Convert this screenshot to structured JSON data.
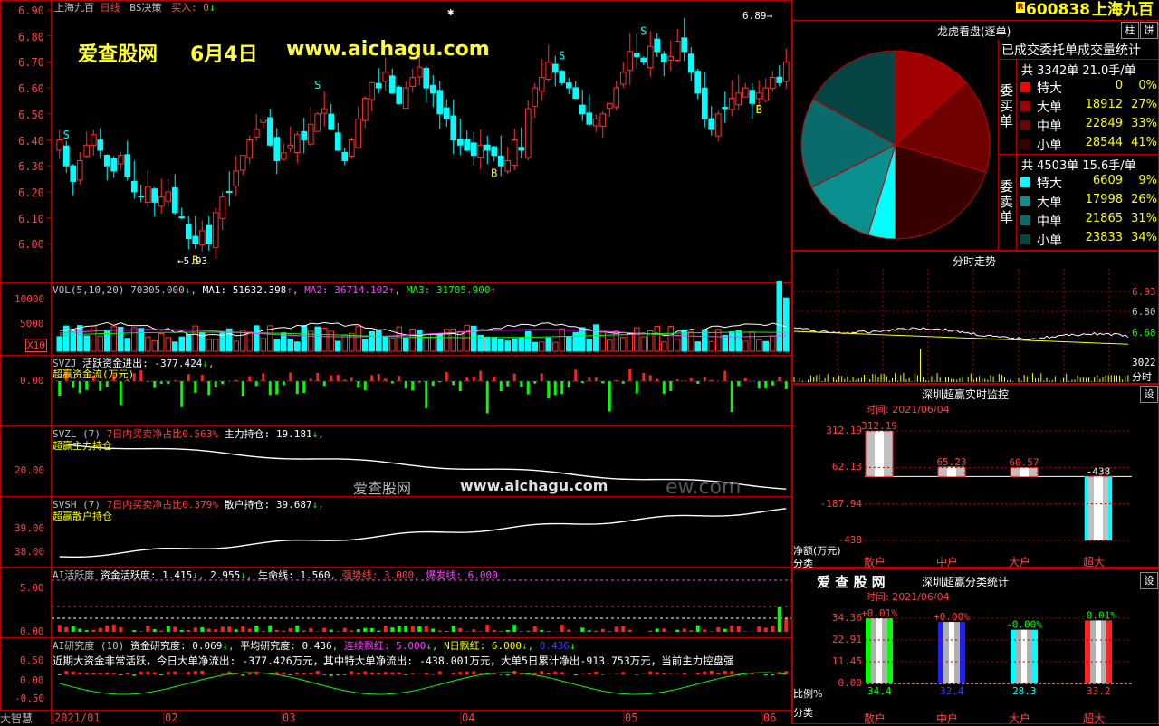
{
  "header": {
    "stock_name": "上海九百",
    "chart_mode": "日线",
    "formula_name": "BS决策",
    "buy_label": "买入: 0",
    "buy_arrow": "↓",
    "stock_code": "600838",
    "badge": "R"
  },
  "watermark": {
    "brand": "爱查股网",
    "date": "6月4日",
    "url": "www.aichagu.com",
    "mid_brand": "爱查股网",
    "mid_url": "www.aichagu.com",
    "mid_tail": "ew.com"
  },
  "main_chart": {
    "y_ticks": [
      "6.90",
      "6.80",
      "6.70",
      "6.60",
      "6.50",
      "6.40",
      "6.30",
      "6.20",
      "6.10",
      "6.00"
    ],
    "high_label": "6.89",
    "low_label": "5.93",
    "x_ticks": [
      "2021/01",
      "02",
      "03",
      "04",
      "05",
      "06"
    ],
    "signals_s": "S",
    "signals_b": "B"
  },
  "vol_panel": {
    "title": "VOL(5,10,20)",
    "vol": "70305.000",
    "ma1_label": "MA1: 51632.398",
    "ma2_label": "MA2: 36714.102",
    "ma3_label": "MA3: 31705.900",
    "y_ticks": [
      "10000",
      "5000"
    ],
    "unit": "X10"
  },
  "svzj_panel": {
    "title": "SVZJ",
    "line1": "活跃资金进出: -377.424",
    "line2": "超赢资金流(万元)",
    "y_tick": "0.00"
  },
  "svzl_panel": {
    "title": "SVZL (7)",
    "ratio_label": "7日内买卖净占比0.563%",
    "hold_label": "主力持仓: 19.181",
    "sub_label": "超赢主力持仓",
    "y_tick": "20.00"
  },
  "svsh_panel": {
    "title": "SVSH (7)",
    "ratio_label": "7日内买卖净占比0.379%",
    "hold_label": "散户持仓: 39.687",
    "sub_label": "超赢散户持仓",
    "y_ticks": [
      "39.00",
      "38.00"
    ]
  },
  "ai_active_panel": {
    "title": "AI活跃度",
    "activity": "资金活跃度: 1.415",
    "value2": "2.955",
    "life_line": "生命线: 1.560",
    "strong_line": "强势线: 3.000",
    "burst_line": "爆发线: 6.000",
    "y_ticks": [
      "5.00",
      "0.00"
    ]
  },
  "ai_research_panel": {
    "title": "AI研究度 (10)",
    "research": "资金研究度: 0.069",
    "avg_research": "平均研究度: 0.436",
    "consecutive": "连续飘红: 5.000",
    "n_day": "N日飘红: 6.000",
    "extra": "0.436",
    "summary": "近期大资金非常活跃，今日大单净流出: -377.426万元，其中特大单净流出: -438.001万元，大单5日累计净出-913.753万元，当前主力控盘强",
    "y_ticks": [
      "0.50",
      "0.00",
      "-0.50"
    ]
  },
  "footer": {
    "logo": "大智慧"
  },
  "dragon_panel": {
    "title": "龙虎看盘(逐单)",
    "tab_col": "柱",
    "tab_pie": "饼",
    "stats_title": "已成交委托单成交量统计",
    "buy_side_label": "委买单",
    "sell_side_label": "委卖单",
    "buy_total": "共 3342单 21.0手/单",
    "sell_total": "共 4503单 15.6手/单",
    "buy_rows": [
      {
        "label": "特大",
        "count": "0",
        "pct": "0%",
        "color": "#ff0000"
      },
      {
        "label": "大单",
        "count": "18912",
        "pct": "27%",
        "color": "#a00000"
      },
      {
        "label": "中单",
        "count": "22849",
        "pct": "33%",
        "color": "#700000"
      },
      {
        "label": "小单",
        "count": "28544",
        "pct": "41%",
        "color": "#3a0000"
      }
    ],
    "sell_rows": [
      {
        "label": "特大",
        "count": "6609",
        "pct": "9%",
        "color": "#00ffff"
      },
      {
        "label": "大单",
        "count": "17998",
        "pct": "26%",
        "color": "#0a8f8f"
      },
      {
        "label": "中单",
        "count": "21865",
        "pct": "31%",
        "color": "#0a6b6b"
      },
      {
        "label": "小单",
        "count": "23833",
        "pct": "34%",
        "color": "#064444"
      }
    ]
  },
  "intraday_panel": {
    "title": "分时走势",
    "price_ticks": [
      "6.93",
      "6.80",
      "6.68"
    ],
    "volume_label": "3022",
    "volume_unit": "分时"
  },
  "monitor_panel": {
    "title": "深圳超赢实时监控",
    "settings": "设",
    "time_label": "时间: 2021/06/04",
    "y_ticks": [
      "312.19",
      "62.13",
      "-187.94",
      "-438"
    ],
    "unit_label": "净额(万元)",
    "class_label": "分类",
    "categories": [
      "散户",
      "中户",
      "大户",
      "超大"
    ]
  },
  "classify_panel": {
    "brand": "爱 查 股 网",
    "title": "深圳超赢分类统计",
    "settings": "设",
    "time_label": "时间: 2021/06/04",
    "y_ticks": [
      "34.36",
      "22.91",
      "11.45",
      "0.00"
    ],
    "ratio_label": "比例%",
    "class_label": "分类",
    "categories": [
      "散户",
      "中户",
      "大户",
      "超大"
    ]
  },
  "chart_data": [
    {
      "type": "bar",
      "title": "深圳超赢实时监控",
      "ylabel": "净额(万元)",
      "categories": [
        "散户",
        "中户",
        "大户",
        "超大"
      ],
      "values": [
        312.19,
        65.23,
        60.57,
        -438
      ],
      "value_labels": [
        "312.19",
        "65.23",
        "60.57",
        "-438"
      ],
      "ylim": [
        -438,
        312.19
      ]
    },
    {
      "type": "bar",
      "title": "深圳超赢分类统计",
      "ylabel": "比例%",
      "categories": [
        "散户",
        "中户",
        "大户",
        "超大"
      ],
      "values": [
        34.4,
        32.4,
        28.3,
        33.2
      ],
      "change_labels": [
        "+0.01%",
        "+0.00%",
        "-0.00%",
        "-0.01%"
      ],
      "bottom_labels": [
        "34.4",
        "32.4",
        "28.3",
        "33.2"
      ],
      "ylim": [
        0,
        34.36
      ]
    },
    {
      "type": "pie",
      "title": "龙虎看盘(逐单)",
      "slices": [
        {
          "name": "买 特大",
          "value": 0
        },
        {
          "name": "买 大单",
          "value": 18912
        },
        {
          "name": "买 中单",
          "value": 22849
        },
        {
          "name": "买 小单",
          "value": 28544
        },
        {
          "name": "卖 特大",
          "value": 6609
        },
        {
          "name": "卖 大单",
          "value": 17998
        },
        {
          "name": "卖 中单",
          "value": 21865
        },
        {
          "name": "卖 小单",
          "value": 23833
        }
      ]
    }
  ]
}
